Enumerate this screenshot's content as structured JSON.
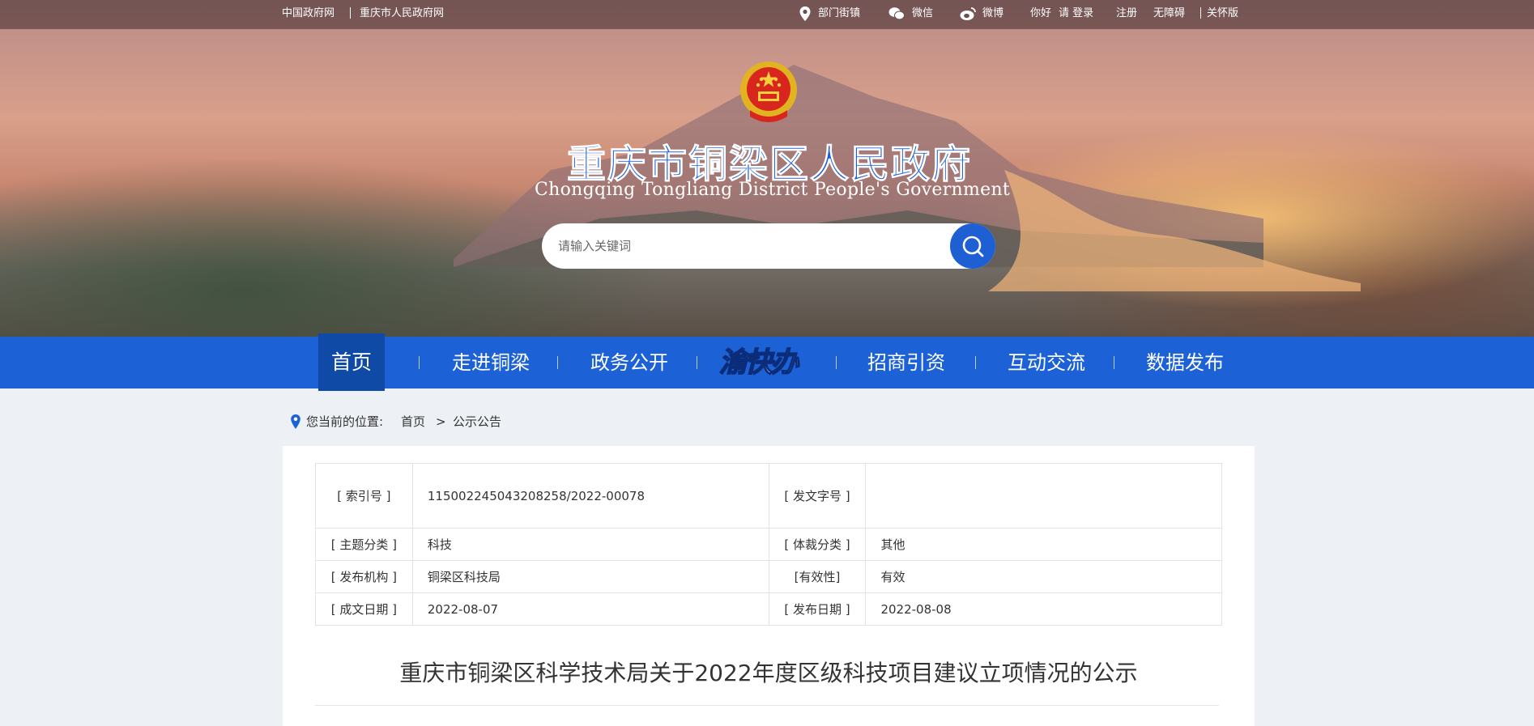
{
  "topbar": {
    "links_left": [
      "中国政府网",
      "重庆市人民政府网"
    ],
    "dept": "部门街镇",
    "wechat": "微信",
    "weibo": "微博",
    "greeting": "你好",
    "login": "请 登录",
    "register": "注册",
    "accessibility": "无障碍",
    "care": "关怀版"
  },
  "header": {
    "title_cn": "重庆市铜梁区人民政府",
    "title_en": "Chongqing Tongliang District People's Government"
  },
  "search": {
    "placeholder": "请输入关键词"
  },
  "nav": {
    "items": [
      "首页",
      "走进铜梁",
      "政务公开",
      "渝快办",
      "招商引资",
      "互动交流",
      "数据发布"
    ]
  },
  "breadcrumb": {
    "label": "您当前的位置:",
    "home": "首页",
    "separator": ">",
    "current": "公示公告"
  },
  "meta": {
    "index_no_label": "[ 索引号 ]",
    "index_no": "115002245043208258/2022-00078",
    "doc_no_label": "[ 发文字号 ]",
    "doc_no": "",
    "topic_label": "[ 主题分类 ]",
    "topic": "科技",
    "genre_label": "[ 体裁分类 ]",
    "genre": "其他",
    "issuer_label": "[ 发布机构 ]",
    "issuer": "铜梁区科技局",
    "validity_label": "[有效性]",
    "validity": "有效",
    "created_label": "[ 成文日期 ]",
    "created": "2022-08-07",
    "published_label": "[ 发布日期 ]",
    "published": "2022-08-08"
  },
  "document": {
    "title": "重庆市铜梁区科学技术局关于2022年度区级科技项目建议立项情况的公示"
  },
  "colors": {
    "nav_bg": "#1c62d6",
    "nav_active": "#0e4aa6",
    "title_blue": "#1a5fd8",
    "page_bg": "#edf1f5"
  }
}
